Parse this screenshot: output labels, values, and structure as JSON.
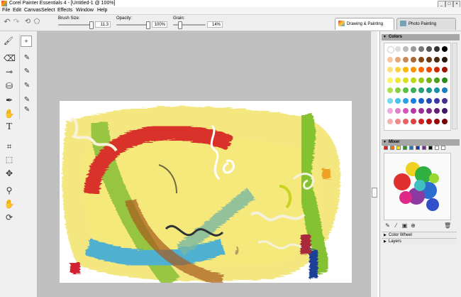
{
  "window": {
    "title": "Corel Painter Essentials 4 - [Untitled-1 @ 100%]",
    "minimize_glyph": "_",
    "maximize_glyph": "□",
    "close_glyph": "×"
  },
  "menu": [
    "File",
    "Edit",
    "Canvas",
    "Select",
    "Effects",
    "Window",
    "Help"
  ],
  "toolbar": {
    "brush_size_label": "Brush Size:",
    "brush_size_value": "11.3",
    "opacity_label": "Opacity:",
    "opacity_value": "100%",
    "grain_label": "Grain:",
    "grain_value": "14%",
    "undo_glyph": "↶",
    "redo_glyph": "↷"
  },
  "tabs": {
    "drawing_painting": "Drawing & Painting",
    "photo_painting": "Photo Painting"
  },
  "panels": {
    "colors": "Colors",
    "mixer": "Mixer",
    "color_wheel": "Color Wheel",
    "layers": "Layers"
  },
  "color_swatches": [
    [
      "#ffffff",
      "#dddddd",
      "#bbbbbb",
      "#999999",
      "#777777",
      "#555555",
      "#333333",
      "#000000"
    ],
    [
      "#f7c8a0",
      "#e8a878",
      "#c88858",
      "#a86838",
      "#884818",
      "#6c3a14",
      "#4a2a10",
      "#2a1808"
    ],
    [
      "#ffe07a",
      "#ffd040",
      "#ffb800",
      "#ff9400",
      "#ff6a00",
      "#f04800",
      "#d02800",
      "#a01400"
    ],
    [
      "#fff36a",
      "#f0e838",
      "#d8e020",
      "#b8d818",
      "#98c818",
      "#70b418",
      "#48a018",
      "#288c18"
    ],
    [
      "#b0e050",
      "#88d040",
      "#58c040",
      "#38b058",
      "#28a078",
      "#189890",
      "#1890a8",
      "#1880c0"
    ],
    [
      "#78d8f0",
      "#48c0f0",
      "#28a0e8",
      "#1880e0",
      "#1860c8",
      "#2848b0",
      "#3838a0",
      "#483090"
    ],
    [
      "#f0a8d8",
      "#e080c8",
      "#d058b8",
      "#b838a8",
      "#983098",
      "#802888",
      "#602078",
      "#401868"
    ],
    [
      "#f8b0b0",
      "#f08888",
      "#e86060",
      "#e04040",
      "#d02020",
      "#b81010",
      "#980808",
      "#780404"
    ]
  ],
  "mixer_swatches": [
    "#e81818",
    "#f07800",
    "#f8e800",
    "#18a018",
    "#1878d0",
    "#1838a0",
    "#782890",
    "#000000",
    "#ffffff",
    "#ffffff"
  ],
  "left_tools": [
    "brush-icon",
    "eraser-icon",
    "dropper-icon",
    "paint-bucket-icon",
    "pen-icon",
    "blender-icon",
    "text-icon",
    "crop-icon",
    "selection-icon",
    "transform-icon",
    "magnifier-icon",
    "grabber-icon",
    "rotate-icon"
  ],
  "mixer_tools": {
    "brush": "✎",
    "dropper": "⁄",
    "sampler": "▣",
    "zoom": "⊕",
    "clear": "🗑"
  }
}
